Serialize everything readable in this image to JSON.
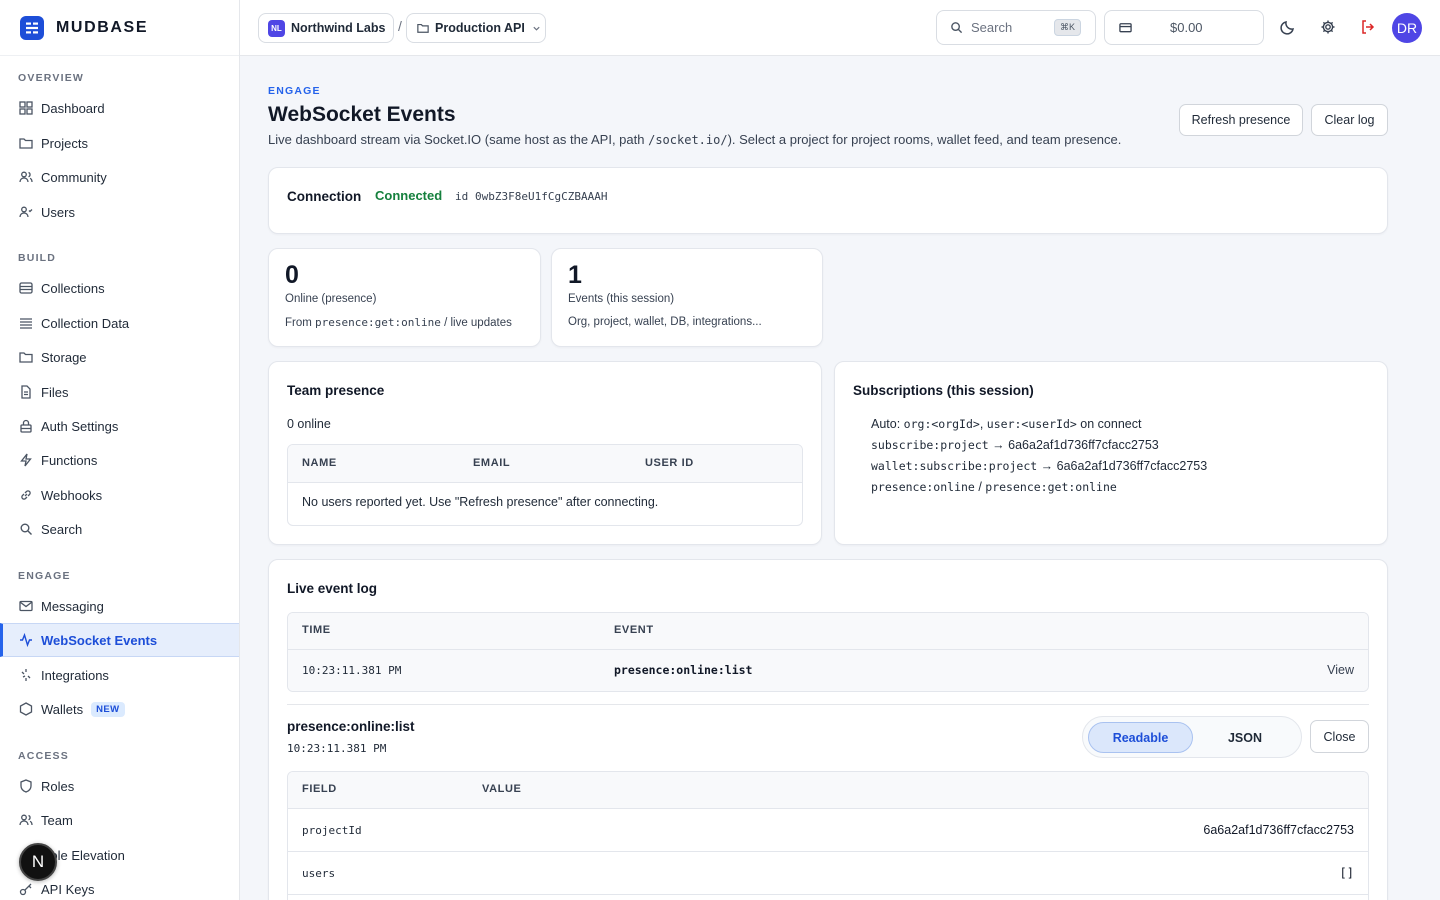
{
  "brand": {
    "name": "MUDBASE"
  },
  "sidebar": {
    "sections": [
      {
        "label": "OVERVIEW"
      },
      {
        "label": "BUILD"
      },
      {
        "label": "ENGAGE"
      },
      {
        "label": "ACCESS"
      }
    ],
    "items": [
      {
        "label": "Dashboard",
        "icon": "grid-icon"
      },
      {
        "label": "Projects",
        "icon": "folder-icon"
      },
      {
        "label": "Community",
        "icon": "users-icon"
      },
      {
        "label": "Users",
        "icon": "user-icon"
      },
      {
        "label": "Collections",
        "icon": "database-icon"
      },
      {
        "label": "Collection Data",
        "icon": "list-icon"
      },
      {
        "label": "Storage",
        "icon": "folder-icon"
      },
      {
        "label": "Files",
        "icon": "file-icon"
      },
      {
        "label": "Auth Settings",
        "icon": "lock-icon"
      },
      {
        "label": "Functions",
        "icon": "bolt-icon"
      },
      {
        "label": "Webhooks",
        "icon": "link-icon"
      },
      {
        "label": "Search",
        "icon": "search-icon"
      },
      {
        "label": "Messaging",
        "icon": "mail-icon"
      },
      {
        "label": "WebSocket Events",
        "icon": "activity-icon"
      },
      {
        "label": "Integrations",
        "icon": "plug-icon"
      },
      {
        "label": "Wallets",
        "icon": "hexagon-icon",
        "badge": "NEW"
      },
      {
        "label": "Roles",
        "icon": "shield-icon"
      },
      {
        "label": "Team",
        "icon": "users-icon"
      },
      {
        "label": "Role Elevation",
        "icon": "arrow-up-icon"
      },
      {
        "label": "API Keys",
        "icon": "key-icon"
      }
    ],
    "floating_badge": "N"
  },
  "topbar": {
    "org_initials": "NL",
    "org_name": "Northwind Labs",
    "separator": "/",
    "project_name": "Production API",
    "search_placeholder": "Search",
    "search_shortcut": "⌘K",
    "wallet_balance": "$0.00",
    "avatar_initials": "DR"
  },
  "page": {
    "eyebrow": "ENGAGE",
    "title": "WebSocket Events",
    "description_pre": "Live dashboard stream via Socket.IO (same host as the API, path ",
    "description_code": "/socket.io/",
    "description_post": "). Select a project for project rooms, wallet feed, and team presence.",
    "refresh_label": "Refresh presence",
    "clear_label": "Clear log"
  },
  "connection": {
    "label": "Connection",
    "status": "Connected",
    "status_color": "#15803d",
    "id_label": "id",
    "id_value": "0wbZ3F8eU1fCgCZBAAAH"
  },
  "stats": [
    {
      "value": "0",
      "label": "Online (presence)",
      "sub_pre": "From ",
      "sub_code": "presence:get:online",
      "sub_post": " / live updates"
    },
    {
      "value": "1",
      "label": "Events (this session)",
      "sub_pre": "Org, project, wallet, DB, integrations...",
      "sub_code": "",
      "sub_post": ""
    }
  ],
  "presence": {
    "title": "Team presence",
    "count_text": "0 online",
    "columns": [
      "NAME",
      "EMAIL",
      "USER ID"
    ],
    "empty_text": "No users reported yet. Use \"Refresh presence\" after connecting."
  },
  "subscriptions": {
    "title": "Subscriptions (this session)",
    "lines": [
      {
        "a": "Auto: ",
        "b": "org:<orgId>",
        "c": ", ",
        "d": "user:<userId>",
        "e": " on connect"
      },
      {
        "a": "",
        "b": "subscribe:project",
        "c": " → 6a6a2af1d736ff7cfacc2753",
        "d": "",
        "e": ""
      },
      {
        "a": "",
        "b": "wallet:subscribe:project",
        "c": " → 6a6a2af1d736ff7cfacc2753",
        "d": "",
        "e": ""
      },
      {
        "a": "",
        "b": "presence:online",
        "c": " / ",
        "d": "presence:get:online",
        "e": ""
      }
    ]
  },
  "event_log": {
    "title": "Live event log",
    "columns": [
      "TIME",
      "EVENT"
    ],
    "rows": [
      {
        "time": "10:23:11.381 PM",
        "event": "presence:online:list",
        "action": "View"
      }
    ]
  },
  "detail": {
    "event": "presence:online:list",
    "time": "10:23:11.381 PM",
    "mode_readable": "Readable",
    "mode_json": "JSON",
    "close_label": "Close",
    "columns": [
      "FIELD",
      "VALUE"
    ],
    "rows": [
      {
        "field": "projectId",
        "value": "6a6a2af1d736ff7cfacc2753"
      },
      {
        "field": "users",
        "value": "[]"
      }
    ]
  }
}
